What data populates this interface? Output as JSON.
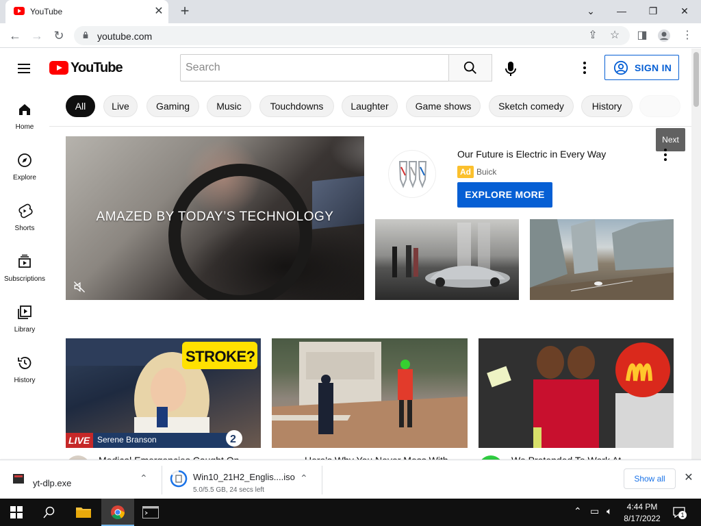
{
  "browser": {
    "tab_title": "YouTube",
    "url": "youtube.com"
  },
  "youtube": {
    "logo_text": "YouTube",
    "search_placeholder": "Search",
    "signin_label": "SIGN IN",
    "sidebar": [
      {
        "label": "Home",
        "icon": "home-icon"
      },
      {
        "label": "Explore",
        "icon": "compass-icon"
      },
      {
        "label": "Shorts",
        "icon": "shorts-icon"
      },
      {
        "label": "Subscriptions",
        "icon": "subscriptions-icon"
      },
      {
        "label": "Library",
        "icon": "library-icon"
      },
      {
        "label": "History",
        "icon": "history-icon"
      }
    ],
    "chips": [
      "All",
      "Live",
      "Gaming",
      "Music",
      "Touchdowns",
      "Laughter",
      "Game shows",
      "Sketch comedy",
      "History"
    ],
    "next_tooltip": "Next",
    "ad": {
      "video_caption": "AMAZED BY TODAY’S TECHNOLOGY",
      "title": "Our Future is Electric in Every Way",
      "badge": "Ad",
      "brand": "Buick",
      "cta": "EXPLORE MORE"
    },
    "videos": [
      {
        "badge_live": "LIVE",
        "lower_third": "Serene Branson",
        "overlay_text": "STROKE?",
        "channel_badge": "2",
        "title": "Medical Emergencies Caught On..."
      },
      {
        "title": "Here's Why You Never Mess With..."
      },
      {
        "title": "We Pretended To Work At..."
      }
    ]
  },
  "downloads": {
    "items": [
      {
        "name": "yt-dlp.exe",
        "status": ""
      },
      {
        "name": "Win10_21H2_Englis....iso",
        "status": "5.0/5.5 GB, 24 secs left"
      }
    ],
    "show_all": "Show all"
  },
  "taskbar": {
    "time": "4:44 PM",
    "date": "8/17/2022",
    "notification_count": "1"
  },
  "colors": {
    "youtube_red": "#ff0000",
    "brand_blue": "#065fd4",
    "ad_badge": "#fbc02d",
    "chrome_tabstrip": "#dee1e6"
  }
}
